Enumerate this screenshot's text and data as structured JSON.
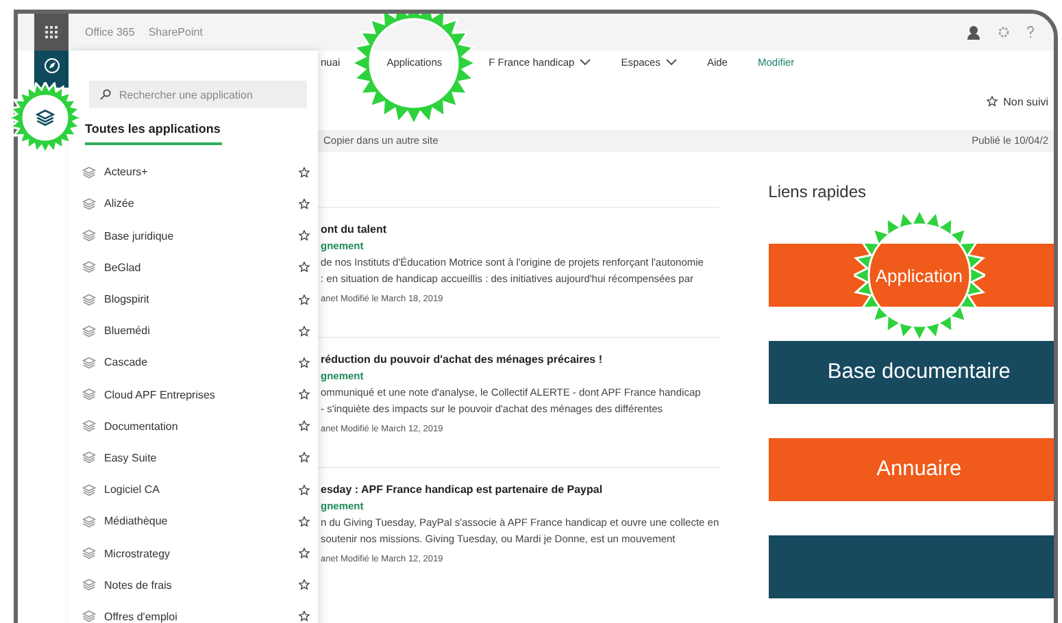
{
  "top_bar": {
    "brand": "Office 365",
    "app": "SharePoint"
  },
  "app_panel": {
    "search": {
      "placeholder": "Rechercher une application"
    },
    "heading": "Toutes les applications",
    "apps": [
      {
        "label": "Acteurs+"
      },
      {
        "label": "Alizée"
      },
      {
        "label": "Base juridique"
      },
      {
        "label": "BeGlad"
      },
      {
        "label": "Blogspirit"
      },
      {
        "label": "Bluemédi"
      },
      {
        "label": "Cascade"
      },
      {
        "label": "Cloud APF Entreprises"
      },
      {
        "label": "Documentation"
      },
      {
        "label": "Easy Suite"
      },
      {
        "label": "Logiciel CA"
      },
      {
        "label": "Médiathèque"
      },
      {
        "label": "Microstrategy"
      },
      {
        "label": "Notes de frais"
      },
      {
        "label": "Offres d'emploi"
      }
    ]
  },
  "nav": [
    {
      "label": "nuai",
      "kind": "link"
    },
    {
      "label": "Applications",
      "kind": "link"
    },
    {
      "label": "F France handicap",
      "kind": "menu"
    },
    {
      "label": "Espaces",
      "kind": "menu"
    },
    {
      "label": "Aide",
      "kind": "link"
    },
    {
      "label": "Modifier",
      "kind": "edit"
    }
  ],
  "follow": "Non suivi",
  "command_bar": {
    "action": "Copier dans un autre site",
    "published": "Publié le 10/04/2"
  },
  "news": [
    {
      "title": "ont du talent",
      "category": "gnement",
      "lines": [
        "de nos Instituts d'Éducation Motrice sont à l'origine de projets renforçant l'autonomie",
        ": en situation de handicap accueillis : des initiatives aujourd'hui récompensées par"
      ],
      "meta": "anet Modifié le March 18, 2019"
    },
    {
      "title": "réduction du pouvoir d'achat des ménages précaires !",
      "category": "gnement",
      "lines": [
        "ommuniqué et une note d'analyse, le Collectif ALERTE - dont APF France handicap",
        "- s'inquiète des impacts sur le pouvoir d'achat des ménages des différentes"
      ],
      "meta": "anet Modifié le March 12, 2019"
    },
    {
      "title": "esday : APF France handicap est partenaire de Paypal",
      "category": "gnement",
      "lines": [
        "n du Giving Tuesday, PayPal s'associe à APF France handicap et ouvre une collecte en",
        "soutenir nos missions. Giving Tuesday, ou Mardi je Donne, est un mouvement"
      ],
      "meta": "anet Modifié le March 12, 2019"
    }
  ],
  "quick_links": {
    "title": "Liens rapides",
    "links": [
      {
        "label": "Application",
        "color": "#f05a1a"
      },
      {
        "label": "Base documentaire",
        "color": "#17495f"
      },
      {
        "label": "Annuaire",
        "color": "#f05a1a"
      },
      {
        "color": "#17495f"
      }
    ]
  }
}
